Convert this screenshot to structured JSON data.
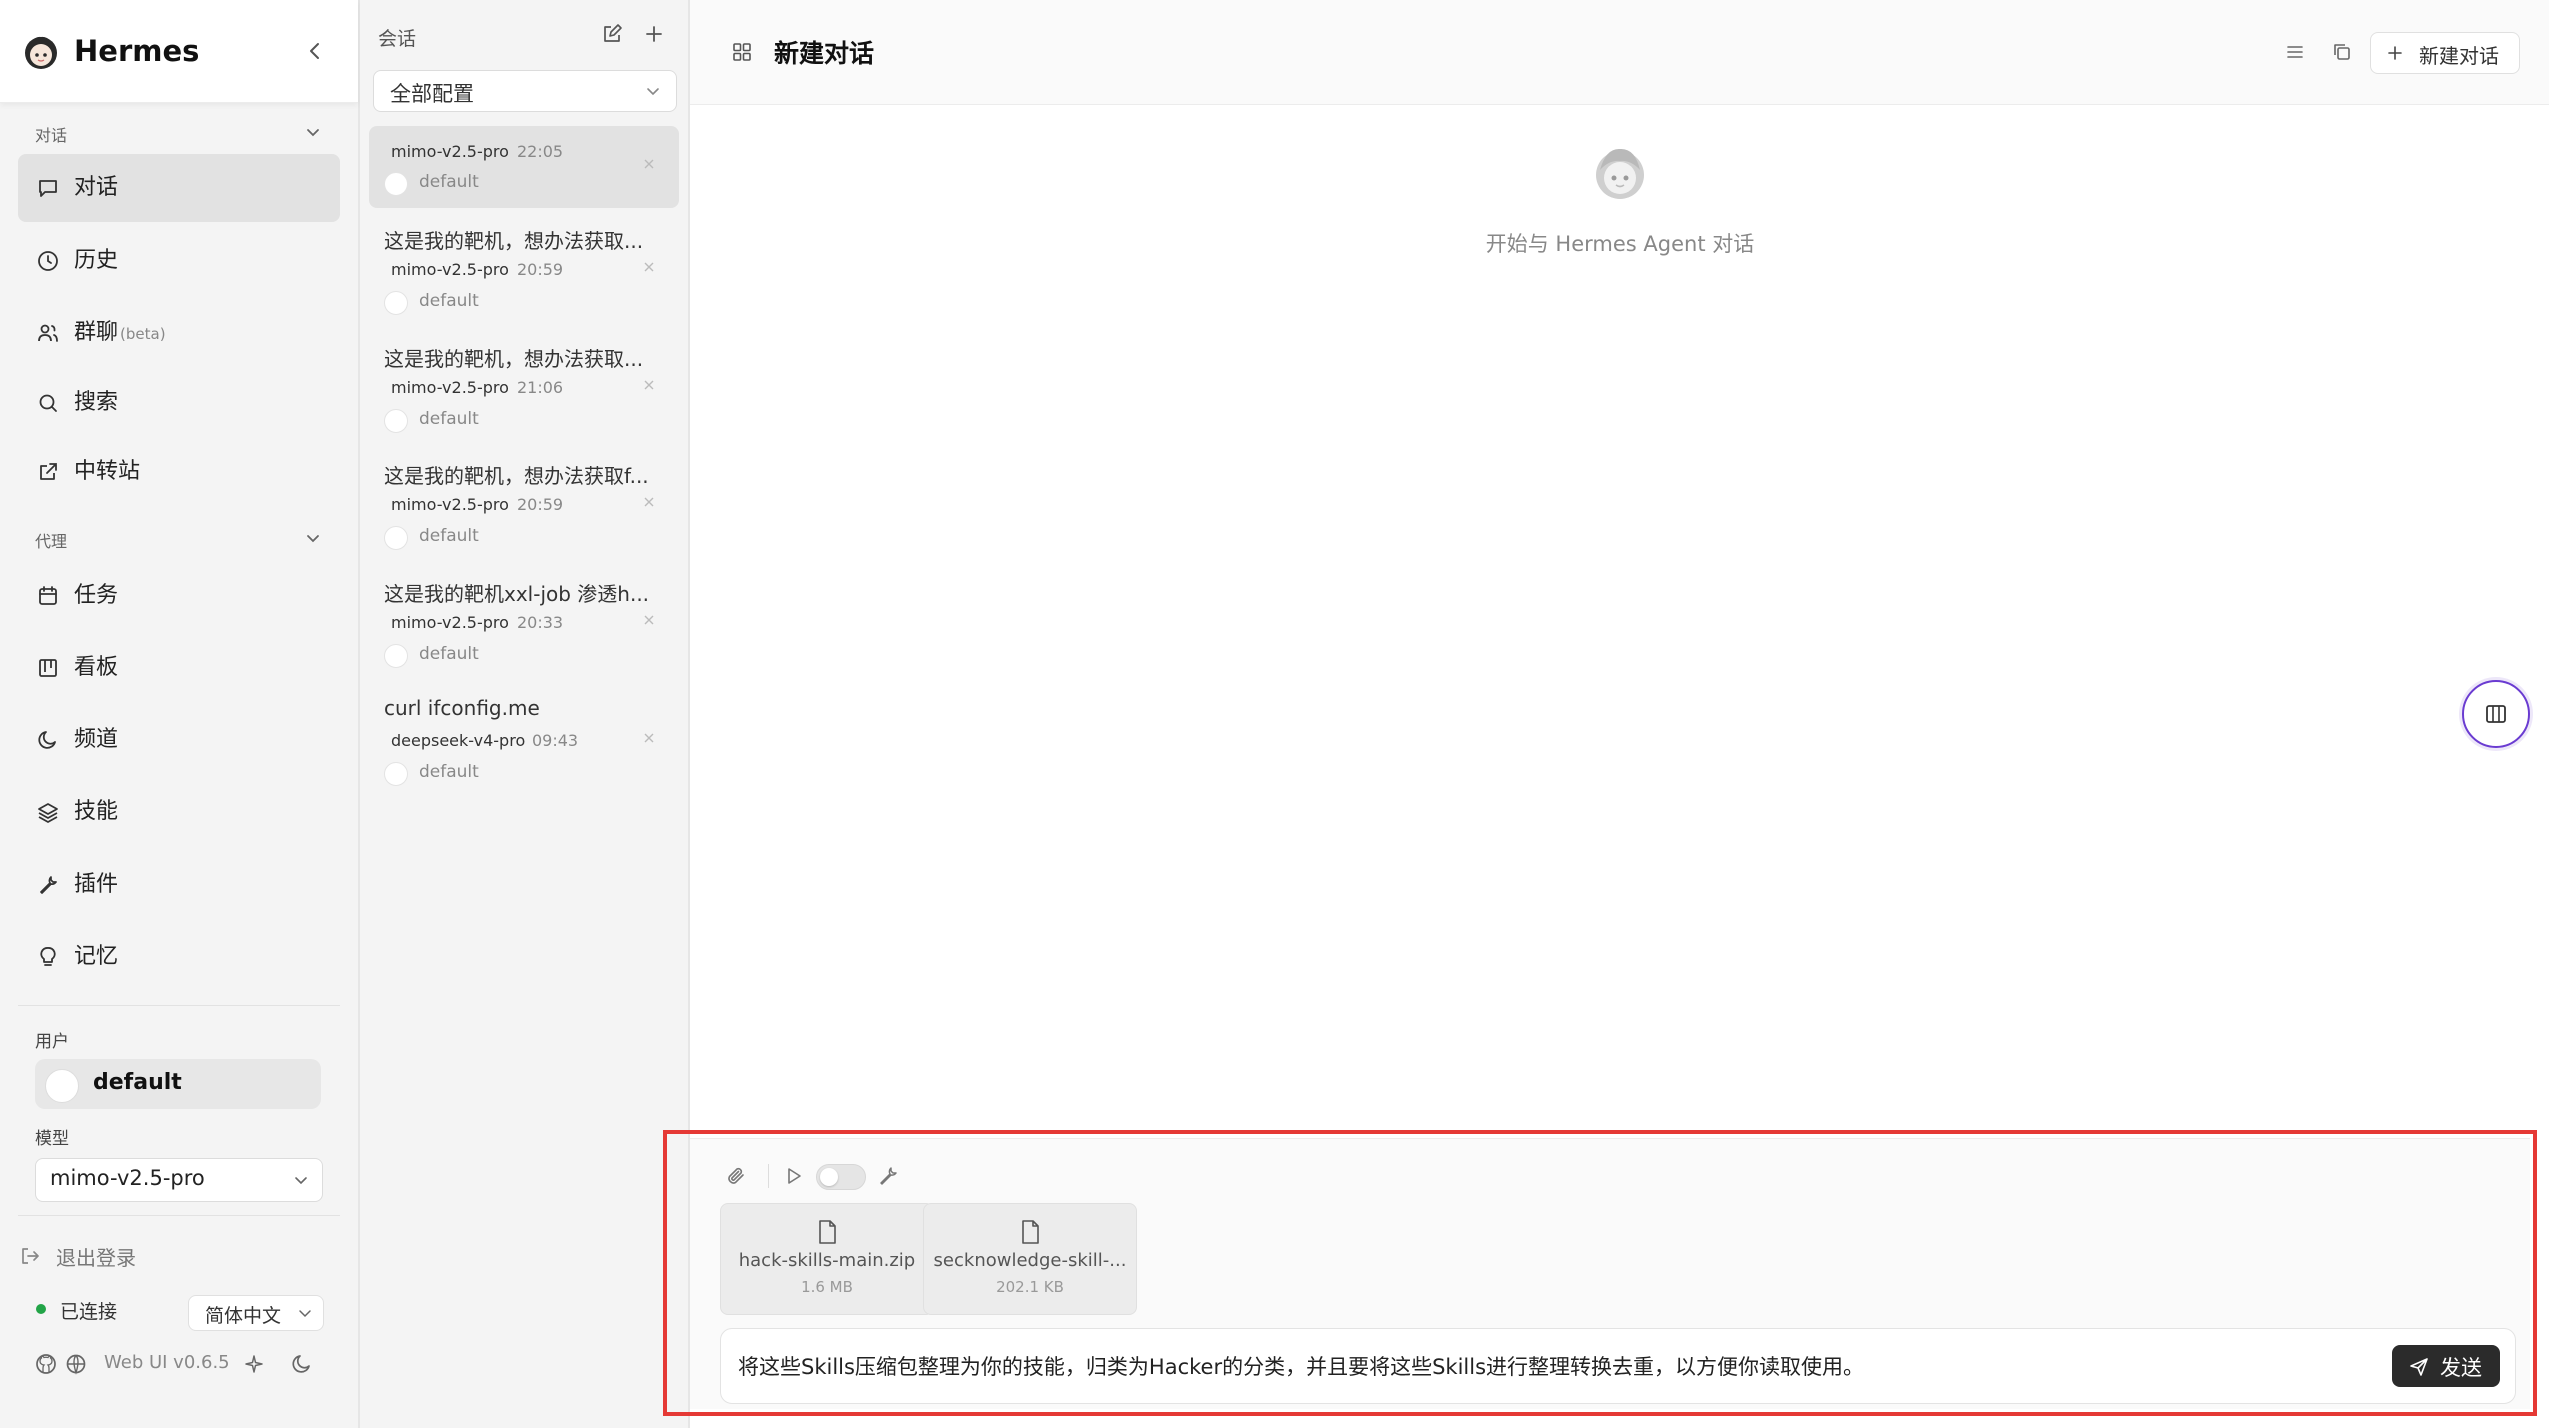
{
  "app": {
    "name": "Hermes"
  },
  "sidebar": {
    "section_chat": "对话",
    "section_agent": "代理",
    "items_chat": [
      {
        "label": "对话",
        "icon": "message-square-icon",
        "active": true
      },
      {
        "label": "历史",
        "icon": "clock-icon"
      },
      {
        "label": "群聊",
        "badge": "(beta)",
        "icon": "users-icon"
      },
      {
        "label": "搜索",
        "icon": "search-icon"
      },
      {
        "label": "中转站",
        "icon": "external-link-icon"
      }
    ],
    "items_agent": [
      {
        "label": "任务",
        "icon": "calendar-icon"
      },
      {
        "label": "看板",
        "icon": "kanban-icon"
      },
      {
        "label": "频道",
        "icon": "moon-icon"
      },
      {
        "label": "技能",
        "icon": "layers-icon"
      },
      {
        "label": "插件",
        "icon": "wrench-icon"
      },
      {
        "label": "记忆",
        "icon": "lightbulb-icon"
      }
    ],
    "user_label": "用户",
    "user_name": "default",
    "model_label": "模型",
    "model_value": "mimo-v2.5-pro",
    "logout": "退出登录",
    "status": "已连接",
    "status_color": "#22a447",
    "language": "简体中文",
    "version": "Web UI v0.6.5"
  },
  "sessions": {
    "title": "会话",
    "filter": "全部配置",
    "items": [
      {
        "title": "",
        "model": "mimo-v2.5-pro",
        "time": "22:05",
        "profile": "default",
        "active": true
      },
      {
        "title": "这是我的靶机，想办法获取...",
        "model": "mimo-v2.5-pro",
        "time": "20:59",
        "profile": "default"
      },
      {
        "title": "这是我的靶机，想办法获取...",
        "model": "mimo-v2.5-pro",
        "time": "21:06",
        "profile": "default"
      },
      {
        "title": "这是我的靶机，想办法获取f...",
        "model": "mimo-v2.5-pro",
        "time": "20:59",
        "profile": "default"
      },
      {
        "title": "这是我的靶机xxl-job 渗透h...",
        "model": "mimo-v2.5-pro",
        "time": "20:33",
        "profile": "default"
      },
      {
        "title": "curl ifconfig.me",
        "model": "deepseek-v4-pro",
        "time": "09:43",
        "profile": "default"
      }
    ]
  },
  "main": {
    "title": "新建对话",
    "new_chat_button": "新建对话",
    "welcome": "开始与 Hermes Agent 对话"
  },
  "composer": {
    "files": [
      {
        "name": "hack-skills-main.zip",
        "size": "1.6 MB"
      },
      {
        "name": "secknowledge-skill-...",
        "size": "202.1 KB"
      }
    ],
    "message": "将这些Skills压缩包整理为你的技能，归类为Hacker的分类，并且要将这些Skills进行整理转换去重，以方便你读取使用。",
    "send": "发送",
    "highlight_color": "#e53935",
    "tool_toggle_on": false
  }
}
